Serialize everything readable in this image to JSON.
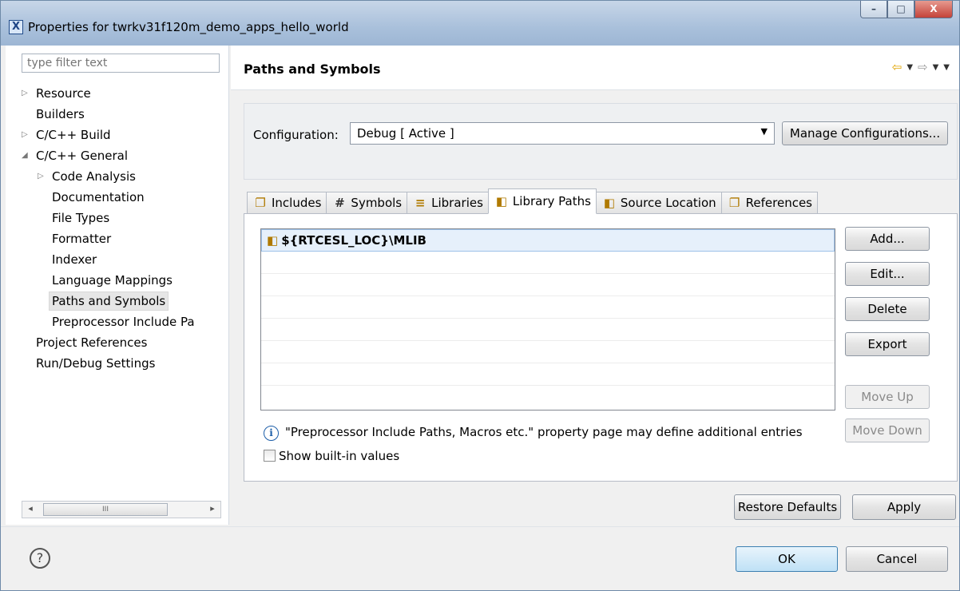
{
  "window": {
    "icon_glyph": "X",
    "title": "Properties for twrkv31f120m_demo_apps_hello_world",
    "min_label": "–",
    "max_label": "□",
    "close_label": "X"
  },
  "sidebar": {
    "filter_placeholder": "type filter text",
    "items": [
      {
        "label": "Resource",
        "twisty": "▷"
      },
      {
        "label": "Builders",
        "twisty": ""
      },
      {
        "label": "C/C++ Build",
        "twisty": "▷"
      },
      {
        "label": "C/C++ General",
        "twisty": "◢"
      },
      {
        "label": "Code Analysis",
        "twisty": "▷"
      },
      {
        "label": "Documentation",
        "twisty": ""
      },
      {
        "label": "File Types",
        "twisty": ""
      },
      {
        "label": "Formatter",
        "twisty": ""
      },
      {
        "label": "Indexer",
        "twisty": ""
      },
      {
        "label": "Language Mappings",
        "twisty": ""
      },
      {
        "label": "Paths and Symbols",
        "twisty": ""
      },
      {
        "label": "Preprocessor Include Pa",
        "twisty": ""
      },
      {
        "label": "Project References",
        "twisty": ""
      },
      {
        "label": "Run/Debug Settings",
        "twisty": ""
      }
    ],
    "scroll_thumb_label": "III",
    "scroll_left": "◂",
    "scroll_right": "▸"
  },
  "main": {
    "title": "Paths and Symbols",
    "nav": {
      "back": "⇦",
      "forward": "⇨",
      "dropdown": "▼"
    },
    "configuration": {
      "label": "Configuration:",
      "value": "Debug  [ Active ]",
      "caret": "▼",
      "manage_button": "Manage Configurations..."
    },
    "tabs": [
      {
        "label": "Includes",
        "icon": "❐"
      },
      {
        "label": "Symbols",
        "icon": "#"
      },
      {
        "label": "Libraries",
        "icon": "≡"
      },
      {
        "label": "Library Paths",
        "icon": "◧"
      },
      {
        "label": "Source Location",
        "icon": "◧"
      },
      {
        "label": "References",
        "icon": "❐"
      }
    ],
    "active_tab_index": 3,
    "library_paths": [
      "${RTCESL_LOC}\\MLIB"
    ],
    "folder_glyph": "◧",
    "side_buttons": {
      "add": "Add...",
      "edit": "Edit...",
      "delete": "Delete",
      "export": "Export",
      "move_up": "Move Up",
      "move_down": "Move Down"
    },
    "info_glyph": "i",
    "info_text": "\"Preprocessor Include Paths, Macros etc.\" property page may define additional entries",
    "show_builtin_label": "Show built-in values",
    "restore_defaults": "Restore Defaults",
    "apply": "Apply"
  },
  "footer": {
    "help_glyph": "?",
    "ok": "OK",
    "cancel": "Cancel"
  }
}
